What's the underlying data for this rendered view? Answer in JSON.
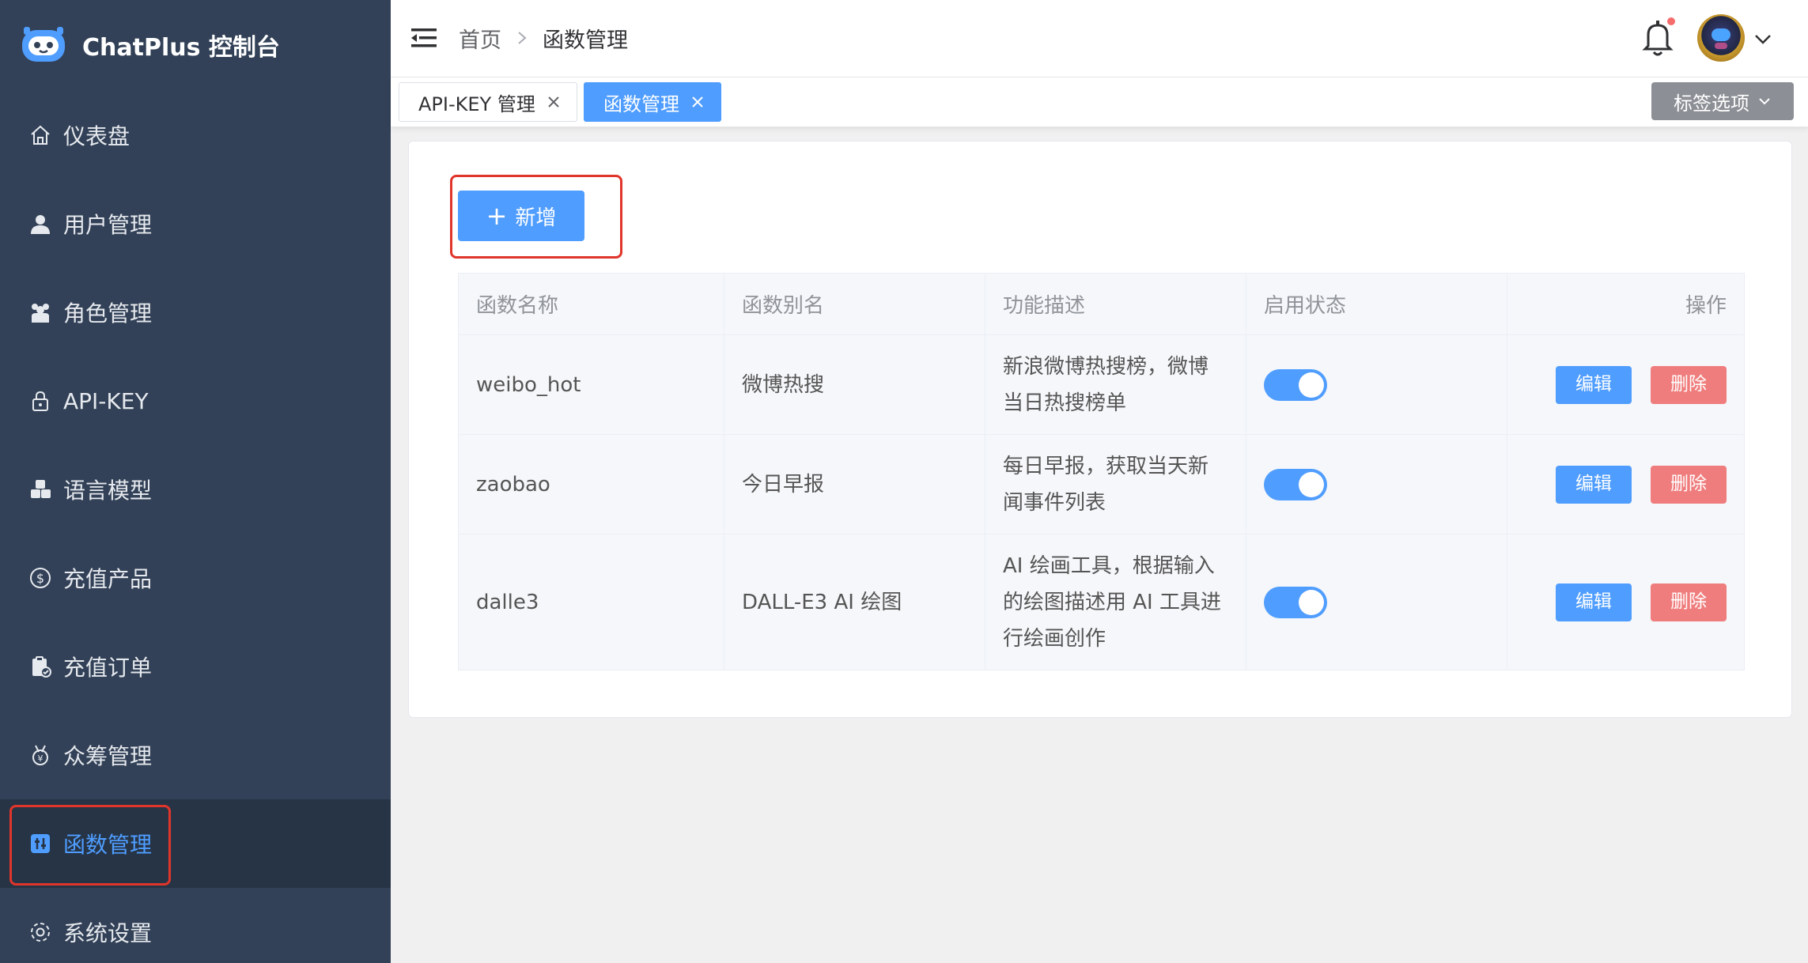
{
  "brand": {
    "title": "ChatPlus 控制台"
  },
  "sidebar": {
    "items": [
      {
        "label": "仪表盘",
        "icon": "home-icon"
      },
      {
        "label": "用户管理",
        "icon": "user-icon"
      },
      {
        "label": "角色管理",
        "icon": "role-icon"
      },
      {
        "label": "API-KEY",
        "icon": "lock-icon"
      },
      {
        "label": "语言模型",
        "icon": "model-icon"
      },
      {
        "label": "充值产品",
        "icon": "dollar-icon"
      },
      {
        "label": "充值订单",
        "icon": "order-icon"
      },
      {
        "label": "众筹管理",
        "icon": "medal-icon"
      },
      {
        "label": "函数管理",
        "icon": "function-icon",
        "active": true
      },
      {
        "label": "系统设置",
        "icon": "gear-icon"
      }
    ]
  },
  "header": {
    "breadcrumb": {
      "home": "首页",
      "current": "函数管理"
    }
  },
  "tabs": {
    "items": [
      {
        "label": "API-KEY 管理",
        "active": false
      },
      {
        "label": "函数管理",
        "active": true
      }
    ],
    "options_label": "标签选项"
  },
  "main": {
    "add_label": "新增",
    "table": {
      "columns": [
        "函数名称",
        "函数别名",
        "功能描述",
        "启用状态",
        "操作"
      ],
      "rows": [
        {
          "name": "weibo_hot",
          "alias": "微博热搜",
          "desc": "新浪微博热搜榜，微博当日热搜榜单",
          "enabled": true
        },
        {
          "name": "zaobao",
          "alias": "今日早报",
          "desc": "每日早报，获取当天新闻事件列表",
          "enabled": true
        },
        {
          "name": "dalle3",
          "alias": "DALL-E3 AI 绘图",
          "desc": "AI 绘画工具，根据输入的绘图描述用 AI 工具进行绘画创作",
          "enabled": true
        }
      ],
      "edit_label": "编辑",
      "delete_label": "删除"
    }
  },
  "colors": {
    "sidebar_bg": "#324157",
    "accent": "#4f9dff",
    "danger": "#f07d7d",
    "highlight": "#e0352b"
  }
}
